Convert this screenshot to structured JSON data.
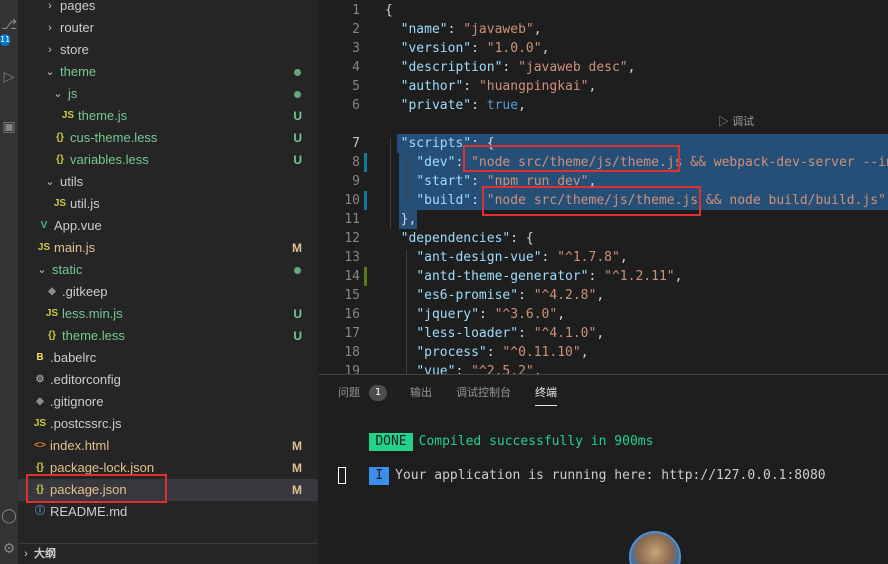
{
  "activity": {
    "badge": "11"
  },
  "explorer": {
    "rows": [
      {
        "chev": "›",
        "icon": "",
        "label": "pages",
        "status": ""
      },
      {
        "chev": "›",
        "icon": "",
        "label": "router",
        "status": ""
      },
      {
        "chev": "›",
        "icon": "",
        "label": "store",
        "status": ""
      },
      {
        "chev": "⌄",
        "icon": "",
        "label": "theme",
        "status": ""
      },
      {
        "chev": "⌄",
        "icon": "",
        "label": "js",
        "status": ""
      },
      {
        "chev": "",
        "icon": "JS",
        "label": "theme.js",
        "status": "U"
      },
      {
        "chev": "",
        "icon": "{}",
        "label": "cus-theme.less",
        "status": "U"
      },
      {
        "chev": "",
        "icon": "{}",
        "label": "variables.less",
        "status": "U"
      },
      {
        "chev": "⌄",
        "icon": "",
        "label": "utils",
        "status": ""
      },
      {
        "chev": "",
        "icon": "JS",
        "label": "util.js",
        "status": ""
      },
      {
        "chev": "",
        "icon": "V",
        "label": "App.vue",
        "status": ""
      },
      {
        "chev": "",
        "icon": "JS",
        "label": "main.js",
        "status": "M"
      },
      {
        "chev": "⌄",
        "icon": "",
        "label": "static",
        "status": ""
      },
      {
        "chev": "",
        "icon": "◆",
        "label": ".gitkeep",
        "status": ""
      },
      {
        "chev": "",
        "icon": "JS",
        "label": "less.min.js",
        "status": "U"
      },
      {
        "chev": "",
        "icon": "{}",
        "label": "theme.less",
        "status": "U"
      },
      {
        "chev": "",
        "icon": "B",
        "label": ".babelrc",
        "status": ""
      },
      {
        "chev": "",
        "icon": "⚙",
        "label": ".editorconfig",
        "status": ""
      },
      {
        "chev": "",
        "icon": "◆",
        "label": ".gitignore",
        "status": ""
      },
      {
        "chev": "",
        "icon": "JS",
        "label": ".postcssrc.js",
        "status": ""
      },
      {
        "chev": "",
        "icon": "<>",
        "label": "index.html",
        "status": "M"
      },
      {
        "chev": "",
        "icon": "{}",
        "label": "package-lock.json",
        "status": "M"
      },
      {
        "chev": "",
        "icon": "{}",
        "label": "package.json",
        "status": "M"
      },
      {
        "chev": "",
        "icon": "ⓘ",
        "label": "README.md",
        "status": ""
      }
    ],
    "outline_label": "大纲"
  },
  "editor": {
    "codelens": "调试",
    "lines": [
      {
        "n": "1",
        "t": [
          [
            "p",
            "{"
          ]
        ]
      },
      {
        "n": "2",
        "t": [
          [
            "p",
            "  "
          ],
          [
            "k",
            "\"name\""
          ],
          [
            "p",
            ": "
          ],
          [
            "s",
            "\"javaweb\""
          ],
          [
            "p",
            ","
          ]
        ]
      },
      {
        "n": "3",
        "t": [
          [
            "p",
            "  "
          ],
          [
            "k",
            "\"version\""
          ],
          [
            "p",
            ": "
          ],
          [
            "s",
            "\"1.0.0\""
          ],
          [
            "p",
            ","
          ]
        ]
      },
      {
        "n": "4",
        "t": [
          [
            "p",
            "  "
          ],
          [
            "k",
            "\"description\""
          ],
          [
            "p",
            ": "
          ],
          [
            "s",
            "\"javaweb desc\""
          ],
          [
            "p",
            ","
          ]
        ]
      },
      {
        "n": "5",
        "t": [
          [
            "p",
            "  "
          ],
          [
            "k",
            "\"author\""
          ],
          [
            "p",
            ": "
          ],
          [
            "s",
            "\"huangpingkai\""
          ],
          [
            "p",
            ","
          ]
        ]
      },
      {
        "n": "6",
        "t": [
          [
            "p",
            "  "
          ],
          [
            "k",
            "\"private\""
          ],
          [
            "p",
            ": "
          ],
          [
            "b",
            "true"
          ],
          [
            "p",
            ","
          ]
        ]
      },
      {
        "n": "7",
        "t": [
          [
            "p",
            "  "
          ],
          [
            "k",
            "\"scripts\""
          ],
          [
            "p",
            ": {"
          ]
        ]
      },
      {
        "n": "8",
        "t": [
          [
            "p",
            "    "
          ],
          [
            "k",
            "\"dev\""
          ],
          [
            "p",
            ": "
          ],
          [
            "s",
            "\"node src/theme/js/theme.js && webpack-dev-server --inline"
          ]
        ]
      },
      {
        "n": "9",
        "t": [
          [
            "p",
            "    "
          ],
          [
            "k",
            "\"start\""
          ],
          [
            "p",
            ": "
          ],
          [
            "s",
            "\"npm run dev\""
          ],
          [
            "p",
            ","
          ]
        ]
      },
      {
        "n": "10",
        "t": [
          [
            "p",
            "    "
          ],
          [
            "k",
            "\"build\""
          ],
          [
            "p",
            ": "
          ],
          [
            "s",
            "\"node src/theme/js/theme.js && node build/build.js\""
          ]
        ]
      },
      {
        "n": "11",
        "t": [
          [
            "p",
            "  },"
          ]
        ]
      },
      {
        "n": "12",
        "t": [
          [
            "p",
            "  "
          ],
          [
            "k",
            "\"dependencies\""
          ],
          [
            "p",
            ": {"
          ]
        ]
      },
      {
        "n": "13",
        "t": [
          [
            "p",
            "    "
          ],
          [
            "k",
            "\"ant-design-vue\""
          ],
          [
            "p",
            ": "
          ],
          [
            "s",
            "\"^1.7.8\""
          ],
          [
            "p",
            ","
          ]
        ]
      },
      {
        "n": "14",
        "t": [
          [
            "p",
            "    "
          ],
          [
            "k",
            "\"antd-theme-generator\""
          ],
          [
            "p",
            ": "
          ],
          [
            "s",
            "\"^1.2.11\""
          ],
          [
            "p",
            ","
          ]
        ]
      },
      {
        "n": "15",
        "t": [
          [
            "p",
            "    "
          ],
          [
            "k",
            "\"es6-promise\""
          ],
          [
            "p",
            ": "
          ],
          [
            "s",
            "\"^4.2.8\""
          ],
          [
            "p",
            ","
          ]
        ]
      },
      {
        "n": "16",
        "t": [
          [
            "p",
            "    "
          ],
          [
            "k",
            "\"jquery\""
          ],
          [
            "p",
            ": "
          ],
          [
            "s",
            "\"^3.6.0\""
          ],
          [
            "p",
            ","
          ]
        ]
      },
      {
        "n": "17",
        "t": [
          [
            "p",
            "    "
          ],
          [
            "k",
            "\"less-loader\""
          ],
          [
            "p",
            ": "
          ],
          [
            "s",
            "\"^4.1.0\""
          ],
          [
            "p",
            ","
          ]
        ]
      },
      {
        "n": "18",
        "t": [
          [
            "p",
            "    "
          ],
          [
            "k",
            "\"process\""
          ],
          [
            "p",
            ": "
          ],
          [
            "s",
            "\"^0.11.10\""
          ],
          [
            "p",
            ","
          ]
        ]
      },
      {
        "n": "19",
        "t": [
          [
            "p",
            "    "
          ],
          [
            "k",
            "\"vue\""
          ],
          [
            "p",
            ": "
          ],
          [
            "s",
            "\"^2.5.2\""
          ],
          [
            "p",
            ","
          ]
        ]
      }
    ]
  },
  "panel": {
    "tabs": [
      "问题",
      "输出",
      "调试控制台",
      "终端"
    ],
    "problems_count": "1",
    "done_tag": "DONE",
    "done_text": "Compiled successfully in 900ms",
    "info_tag": "I",
    "info_text": "Your application is running here: http://127.0.0.1:8080"
  },
  "colors": {
    "untracked": "#73c991",
    "modified": "#e2c08d",
    "highlight_box": "#e03131",
    "selection": "#264f78"
  }
}
